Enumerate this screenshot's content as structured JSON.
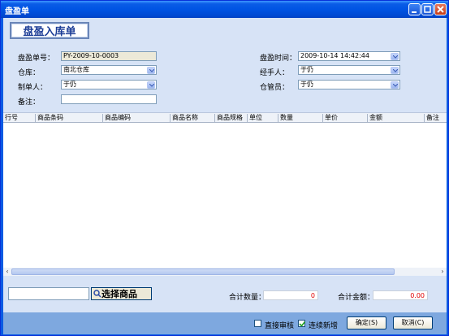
{
  "window": {
    "title": "盘盈单"
  },
  "header": {
    "banner": "盘盈入库单"
  },
  "form": {
    "doc_no_label": "盘盈单号：",
    "doc_no": "PY-2009-10-0003",
    "warehouse_label": "仓库：",
    "warehouse": "南北仓库",
    "maker_label": "制单人：",
    "maker": "于仍",
    "remark_label": "备注：",
    "remark": "",
    "time_label": "盘盈时间：",
    "time": "2009-10-14 14:42:44",
    "handler_label": "经手人：",
    "handler": "于仍",
    "keeper_label": "仓管员：",
    "keeper": "于仍"
  },
  "grid": {
    "columns": [
      "行号",
      "商品条码",
      "商品编码",
      "商品名称",
      "商品规格",
      "单位",
      "数量",
      "单价",
      "金额",
      "备注"
    ]
  },
  "bottom": {
    "select_goods": "选择商品",
    "total_qty_label": "合计数量：",
    "total_qty": "0",
    "total_amount_label": "合计金额：",
    "total_amount": "0.00"
  },
  "footer": {
    "direct_review": "直接审核",
    "direct_review_checked": false,
    "continuous_add": "连续新增",
    "continuous_add_checked": true,
    "ok": "确定(S)",
    "cancel": "取消(C)"
  }
}
